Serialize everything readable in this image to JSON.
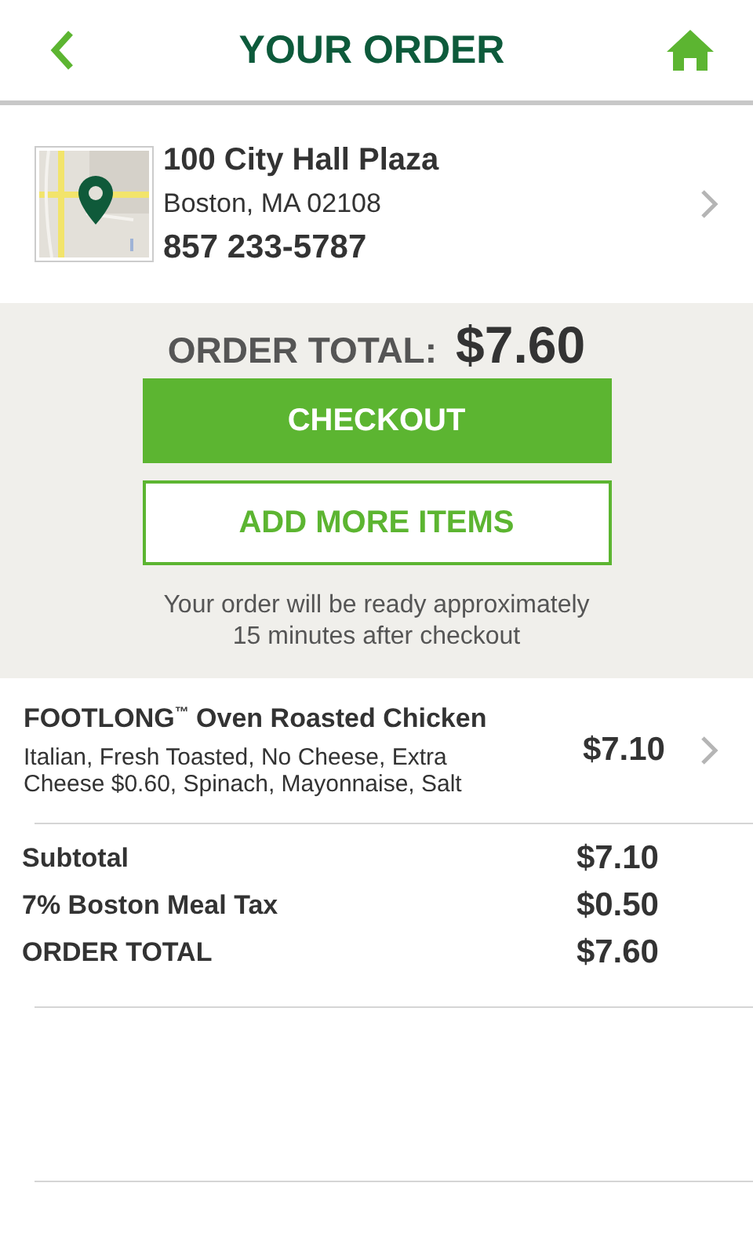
{
  "header": {
    "title": "YOUR ORDER"
  },
  "store": {
    "address": "100 City Hall Plaza",
    "city": "Boston, MA 02108",
    "phone": "857 233-5787"
  },
  "order": {
    "total_label": "ORDER TOTAL:",
    "total": "$7.60",
    "checkout": "CHECKOUT",
    "add_more": "ADD MORE ITEMS",
    "note": "Your order will be ready approximately 15 minutes after checkout"
  },
  "items": [
    {
      "name": "FOOTLONG$^{™}$ Oven Roasted Chicken",
      "details": "Italian, Fresh Toasted, No Cheese, Extra Cheese $0.60, Spinach, Mayonnaise, Salt",
      "price": "$7.10"
    }
  ],
  "summary": [
    {
      "label": "Subtotal",
      "value": "$7.10"
    },
    {
      "label": "7% Boston Meal Tax",
      "value": "$0.50"
    },
    {
      "label": "ORDER TOTAL",
      "value": "$7.60"
    }
  ]
}
